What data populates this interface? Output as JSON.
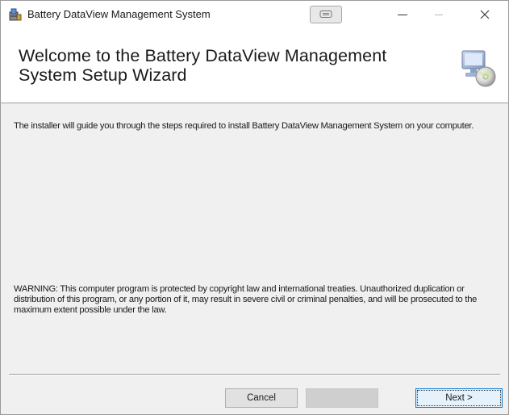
{
  "window": {
    "title": "Battery DataView Management System",
    "icon": "installer-icon"
  },
  "titlebar": {
    "restore_icon": "window-pill-icon",
    "minimize_icon": "minimize-icon",
    "maximize_icon": "maximize-icon",
    "close_icon": "close-icon"
  },
  "banner": {
    "title": "Welcome to the Battery DataView Management System Setup Wizard",
    "icon": "setup-computer-disc-icon"
  },
  "body": {
    "intro": "The installer will guide you through the steps required to install Battery DataView Management System on your computer.",
    "warning": "WARNING: This computer program is protected by copyright law and international treaties. Unauthorized duplication or distribution of this program, or any portion of it, may result in severe civil or criminal penalties, and will be prosecuted to the maximum extent possible under the law."
  },
  "buttons": {
    "cancel": "Cancel",
    "back": "",
    "next": "Next >"
  },
  "colors": {
    "accent": "#0078d7",
    "window_bg": "#f0f0f0",
    "banner_bg": "#ffffff"
  }
}
